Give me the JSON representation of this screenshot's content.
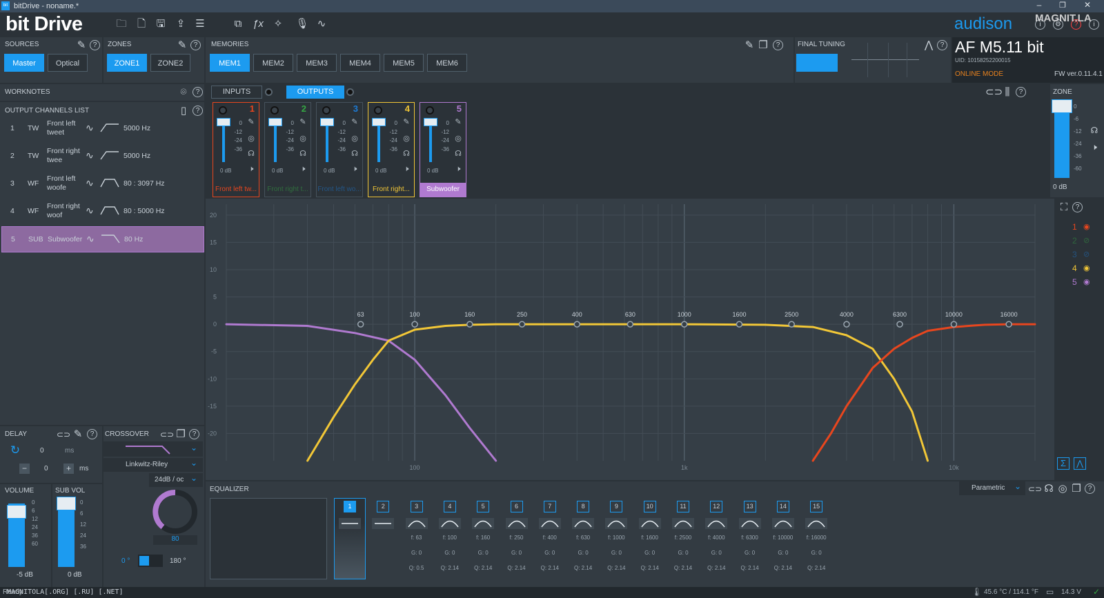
{
  "window": {
    "title": "bitDrive - noname.*",
    "app_badge": "bit"
  },
  "brand": {
    "logo": "bit Drive",
    "vendor": "audison",
    "device": "AF M5.11 bit",
    "uid": "UID: 10158252200015",
    "mode": "ONLINE MODE",
    "fw": "FW ver.0.11.4.1",
    "watermark": "MAGNIT.LA"
  },
  "sources": {
    "label": "SOURCES",
    "buttons": [
      "Master",
      "Optical"
    ],
    "active": "Master"
  },
  "zones": {
    "label": "ZONES",
    "buttons": [
      "ZONE1",
      "ZONE2"
    ],
    "active": "ZONE1"
  },
  "memories": {
    "label": "MEMORIES",
    "buttons": [
      "MEM1",
      "MEM2",
      "MEM3",
      "MEM4",
      "MEM5",
      "MEM6"
    ],
    "active": "MEM1"
  },
  "final_tuning": {
    "label": "FINAL TUNING"
  },
  "worknotes": {
    "label": "WORKNOTES"
  },
  "io_tabs": {
    "inputs": "INPUTS",
    "outputs": "OUTPUTS",
    "active": "OUTPUTS"
  },
  "output_list": {
    "label": "OUTPUT CHANNELS LIST",
    "rows": [
      {
        "n": "1",
        "type": "TW",
        "name1": "Front left",
        "name2": "tweet",
        "freq": "5000 Hz"
      },
      {
        "n": "2",
        "type": "TW",
        "name1": "Front right",
        "name2": "twee",
        "freq": "5000 Hz"
      },
      {
        "n": "3",
        "type": "WF",
        "name1": "Front left",
        "name2": "woofe",
        "freq": "80 : 3097 Hz"
      },
      {
        "n": "4",
        "type": "WF",
        "name1": "Front right",
        "name2": "woof",
        "freq": "80 : 5000 Hz"
      },
      {
        "n": "5",
        "type": "SUB",
        "name1": "Subwoofer",
        "name2": "",
        "freq": "80 Hz"
      }
    ]
  },
  "channels": [
    {
      "n": "1",
      "name": "Front left tw...",
      "color": "#e8461e",
      "db": "0 dB"
    },
    {
      "n": "2",
      "name": "Front right t...",
      "color": "#35a844",
      "db": "0 dB"
    },
    {
      "n": "3",
      "name": "Front left wo...",
      "color": "#1c7bd6",
      "db": "0 dB"
    },
    {
      "n": "4",
      "name": "Front right...",
      "color": "#f2c737",
      "db": "0 dB"
    },
    {
      "n": "5",
      "name": "Subwoofer",
      "color": "#b07ad0",
      "db": "0 dB"
    }
  ],
  "fader_scale": [
    "0",
    "-12",
    "-24",
    "-36"
  ],
  "zone": {
    "label": "ZONE",
    "db": "0 dB",
    "scale": [
      "0",
      "-6",
      "-12",
      "-24",
      "-36",
      "-60"
    ]
  },
  "graph_legend": [
    "1",
    "2",
    "3",
    "4",
    "5"
  ],
  "chart_data": {
    "type": "line",
    "y_ticks": [
      "20",
      "15",
      "10",
      "5",
      "0",
      "-5",
      "-10",
      "-15",
      "-20"
    ],
    "ylim": [
      -25,
      22
    ],
    "freq_labels": [
      "63",
      "100",
      "160",
      "250",
      "400",
      "630",
      "1000",
      "1600",
      "2500",
      "4000",
      "6300",
      "10000",
      "16000"
    ],
    "x_ticks": [
      "100",
      "1k",
      "10k"
    ],
    "series": [
      {
        "color": "#b07ad0",
        "x": [
          20,
          40,
          60,
          80,
          100,
          130,
          160,
          200
        ],
        "y": [
          0,
          -0.3,
          -1.6,
          -3,
          -6.5,
          -13,
          -19,
          -25
        ]
      },
      {
        "color": "#f2c737",
        "x": [
          40,
          50,
          60,
          70,
          80,
          100,
          130,
          160,
          200,
          300,
          500,
          1000,
          2000,
          3000,
          4000,
          5000,
          6000,
          7000,
          8000
        ],
        "y": [
          -25,
          -17,
          -11,
          -6.5,
          -3,
          -1,
          -0.3,
          -0.1,
          0,
          0,
          0,
          0,
          -0.1,
          -0.5,
          -2,
          -4.5,
          -10,
          -16,
          -25
        ]
      },
      {
        "color": "#e8461e",
        "x": [
          3000,
          3500,
          4000,
          5000,
          6000,
          7000,
          8000,
          10000,
          13000,
          16000,
          20000
        ],
        "y": [
          -25,
          -20,
          -15,
          -8,
          -4.5,
          -2.5,
          -1.2,
          -0.5,
          -0.1,
          0,
          0
        ]
      }
    ]
  },
  "delay": {
    "label": "DELAY",
    "value": "0",
    "unit": "ms",
    "fine": "0",
    "fine_unit": "ms",
    "minus": "−",
    "plus": "+"
  },
  "crossover": {
    "label": "CROSSOVER",
    "type": "Linkwitz-Riley",
    "slope": "24dB / oc",
    "knob_value": "80",
    "phase0": "0 °",
    "phase180": "180 °"
  },
  "volume": {
    "label": "VOLUME",
    "db": "-5 dB",
    "scale": [
      "0",
      "6",
      "12",
      "24",
      "36",
      "60"
    ]
  },
  "sub_vol": {
    "label": "SUB VOL",
    "db": "0 dB",
    "scale": [
      "0",
      "6",
      "12",
      "24",
      "36"
    ]
  },
  "equalizer": {
    "label": "EQUALIZER",
    "mode": "Parametric",
    "bands": [
      {
        "n": "1",
        "f": "",
        "g": "",
        "q": ""
      },
      {
        "n": "2",
        "f": "",
        "g": "",
        "q": ""
      },
      {
        "n": "3",
        "f": "f: 63",
        "g": "G: 0",
        "q": "Q: 0.5"
      },
      {
        "n": "4",
        "f": "f: 100",
        "g": "G: 0",
        "q": "Q: 2.14"
      },
      {
        "n": "5",
        "f": "f: 160",
        "g": "G: 0",
        "q": "Q: 2.14"
      },
      {
        "n": "6",
        "f": "f: 250",
        "g": "G: 0",
        "q": "Q: 2.14"
      },
      {
        "n": "7",
        "f": "f: 400",
        "g": "G: 0",
        "q": "Q: 2.14"
      },
      {
        "n": "8",
        "f": "f: 630",
        "g": "G: 0",
        "q": "Q: 2.14"
      },
      {
        "n": "9",
        "f": "f: 1000",
        "g": "G: 0",
        "q": "Q: 2.14"
      },
      {
        "n": "10",
        "f": "f: 1600",
        "g": "G: 0",
        "q": "Q: 2.14"
      },
      {
        "n": "11",
        "f": "f: 2500",
        "g": "G: 0",
        "q": "Q: 2.14"
      },
      {
        "n": "12",
        "f": "f: 4000",
        "g": "G: 0",
        "q": "Q: 2.14"
      },
      {
        "n": "13",
        "f": "f: 6300",
        "g": "G: 0",
        "q": "Q: 2.14"
      },
      {
        "n": "14",
        "f": "f: 10000",
        "g": "G: 0",
        "q": "Q: 2.14"
      },
      {
        "n": "15",
        "f": "f: 16000",
        "g": "G: 0",
        "q": "Q: 2.14"
      }
    ]
  },
  "status": {
    "left": "Ready",
    "watermark": "MAGNITOLA[.ORG] [.RU] [.NET]",
    "temp": "45.6 °C / 114.1 °F",
    "volt": "14.3 V"
  }
}
